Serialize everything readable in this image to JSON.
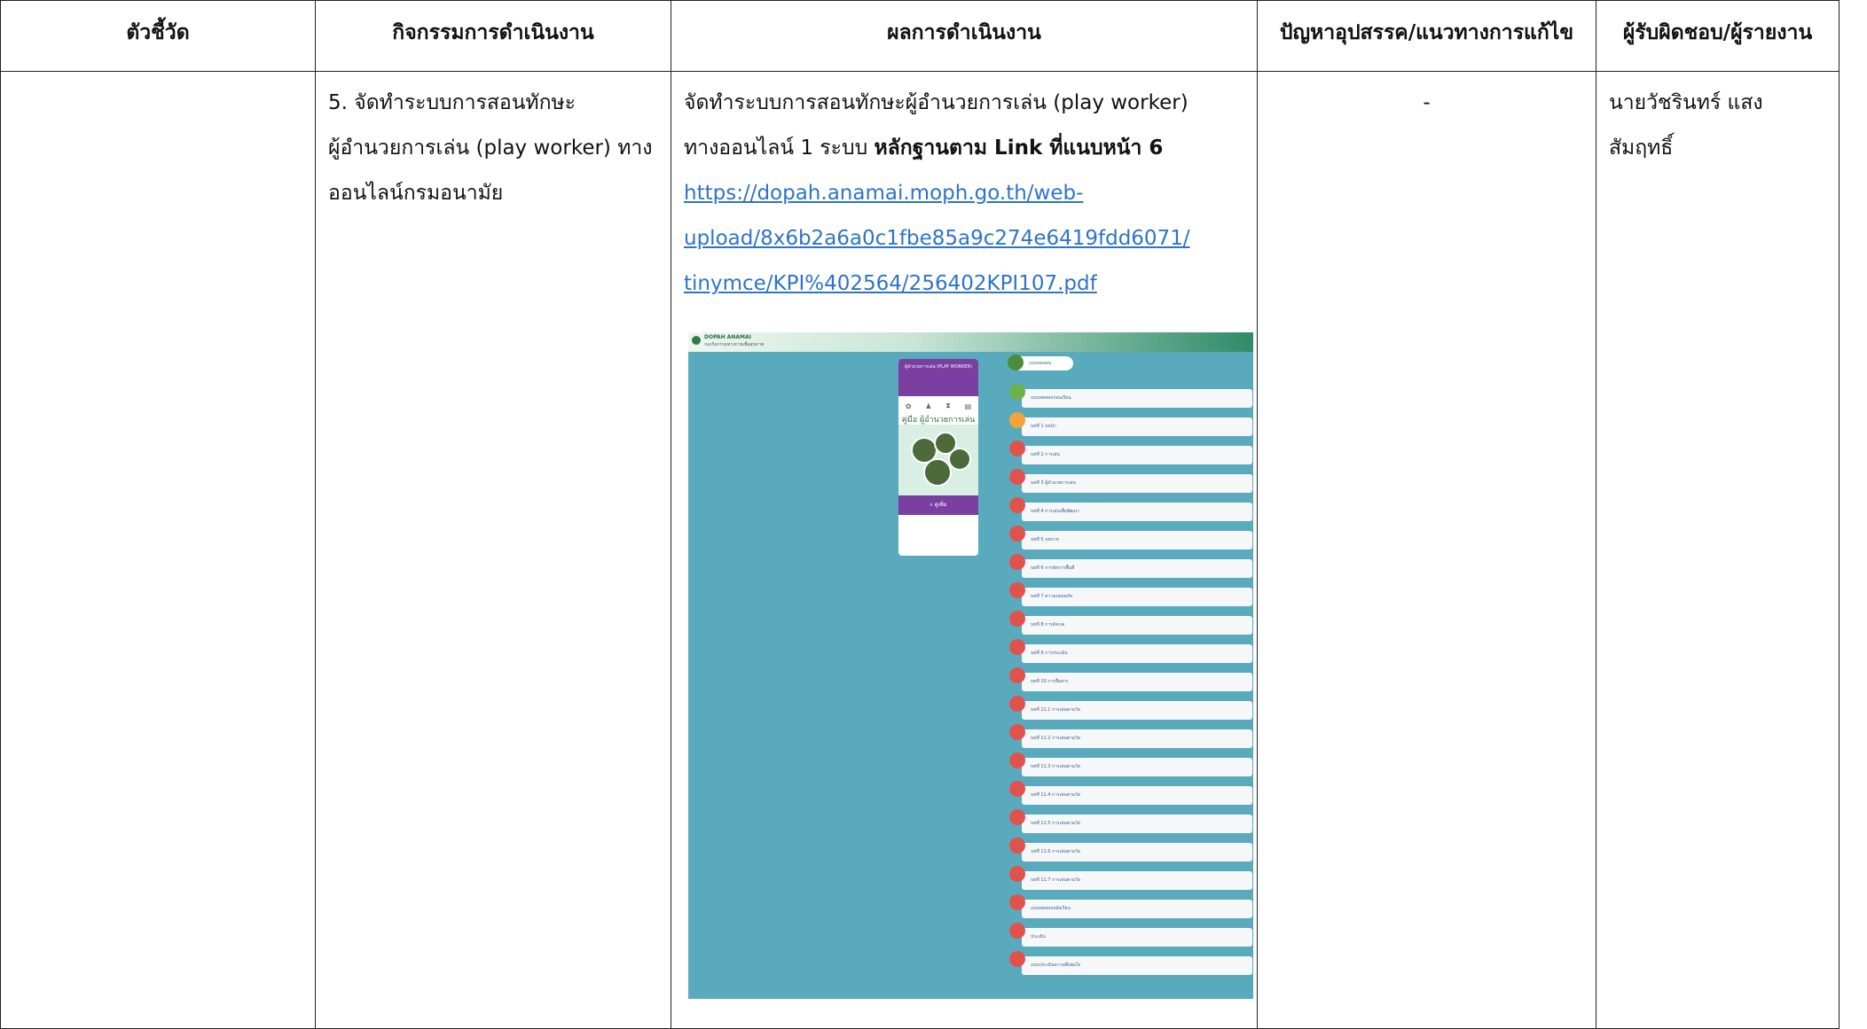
{
  "headers": [
    "ตัวชี้วัด",
    "กิจกรรมการดำเนินงาน",
    "ผลการดำเนินงาน",
    "ปัญหาอุปสรรค/แนวทางการแก้ไข",
    "ผู้รับผิดชอบ/ผู้รายงาน"
  ],
  "row": {
    "indicator": "",
    "activity_lines": [
      "5. จัดทำระบบการสอนทักษะ",
      "ผู้อำนวยการเล่น (play worker) ทาง",
      "ออนไลน์กรมอนามัย"
    ],
    "result_line1": "จัดทำระบบการสอนทักษะผู้อำนวยการเล่น (play worker)",
    "result_line2_prefix": "ทางออนไลน์ 1 ระบบ ",
    "result_line2_bold": "หลักฐานตาม Link ที่แนบหน้า 6",
    "link_lines": [
      "https://dopah.anamai.moph.go.th/web-",
      "upload/8x6b2a6a0c1fbe85a9c274e6419fdd6071/",
      "tinymce/KPI%402564/256402KPI107.pdf"
    ],
    "problem": "-",
    "responsible": "นายวัชรินทร์ แสงสัมฤทธิ์"
  },
  "screenshot": {
    "site_brand": "DOPAH ANAMAI",
    "site_sub": "กองกิจกรรมทางกายเพื่อสุขภาพ",
    "book_header": "ผู้อำนวยการเล่น (PLAY WORKER)",
    "book_title": "คู่มือ ผู้อำนวยการเล่น",
    "book_footer": "ดูเพิ่ม",
    "menu_title": "แบบทดสอบ",
    "menu_items": [
      "แบบทดสอบก่อนเรียน",
      "บทที่ 1 บทนำ",
      "บทที่ 2 การเล่น",
      "บทที่ 3 ผู้อำนวยการเล่น",
      "บทที่ 4 การเล่นเพื่อพัฒนา",
      "บทที่ 5 บทบาท",
      "บทที่ 6 การจัดการพื้นที่",
      "บทที่ 7 ความปลอดภัย",
      "บทที่ 8 การสังเกต",
      "บทที่ 9 การประเมิน",
      "บทที่ 10 การสื่อสาร",
      "บทที่ 11.1 การเล่นตามวัย",
      "บทที่ 11.2 การเล่นตามวัย",
      "บทที่ 11.3 การเล่นตามวัย",
      "บทที่ 11.4 การเล่นตามวัย",
      "บทที่ 11.5 การเล่นตามวัย",
      "บทที่ 11.6 การเล่นตามวัย",
      "บทที่ 11.7 การเล่นตามวัย",
      "แบบทดสอบหลังเรียน",
      "ประเมิน",
      "แบบประเมินความพึงพอใจ"
    ]
  }
}
